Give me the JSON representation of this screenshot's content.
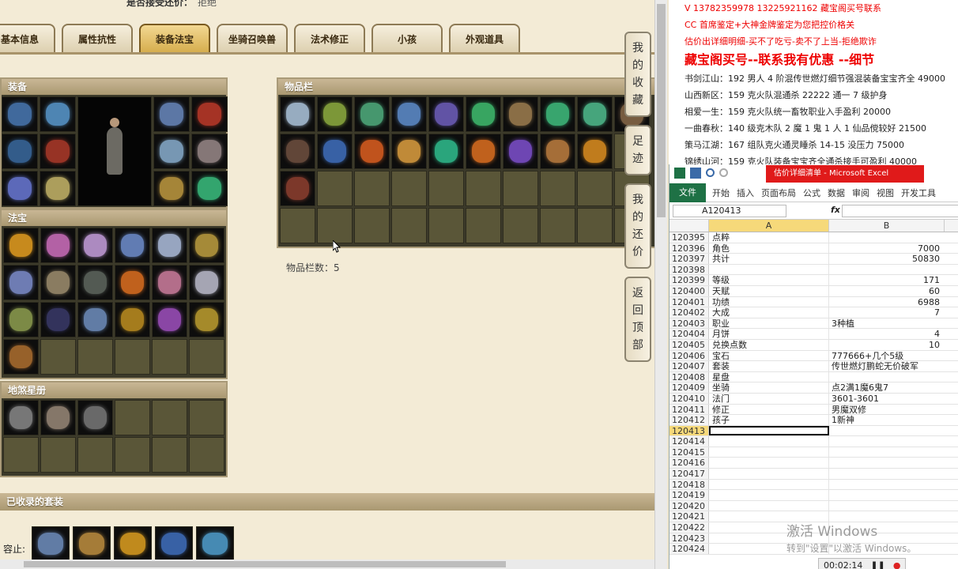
{
  "game": {
    "top_line": {
      "label": "是否接受还价：",
      "value": "拒绝"
    },
    "tabs": [
      {
        "label": "基本信息",
        "active": false
      },
      {
        "label": "属性抗性",
        "active": false
      },
      {
        "label": "装备法宝",
        "active": true
      },
      {
        "label": "坐骑召唤兽",
        "active": false
      },
      {
        "label": "法术修正",
        "active": false
      },
      {
        "label": "小孩",
        "active": false
      },
      {
        "label": "外观道具",
        "active": false
      }
    ],
    "panels": {
      "equip": "装备",
      "fabao": "法宝",
      "star": "地煞星册",
      "items": "物品栏",
      "sets": "已收录的套装"
    },
    "items_count": "物品栏数：5",
    "sets_label": "容止:",
    "side_buttons": [
      {
        "label": "我的收藏",
        "chars": [
          "我",
          "的",
          "收",
          "藏"
        ]
      },
      {
        "label": "足迹",
        "chars": [
          "足",
          "迹"
        ]
      },
      {
        "label": "我的还价",
        "chars": [
          "我",
          "的",
          "还",
          "价"
        ]
      },
      {
        "label": "返回顶部",
        "chars": [
          "返",
          "回",
          "顶",
          "部"
        ]
      }
    ],
    "equip_left_colors": [
      "#4a7ab5",
      "#5a9ad0",
      "#3a6aa0",
      "#b03a2a",
      "#6a7ad8",
      "#c8b86a"
    ],
    "equip_right_colors": [
      "#6a8ac0",
      "#c03a2a",
      "#8ab0d0",
      "#9a8a8a",
      "#c09a40",
      "#3ac080"
    ],
    "fabao_colors": [
      "#e8a020",
      "#d070c0",
      "#c8a0e0",
      "#7090d0",
      "#b0c0e0",
      "#c0a040",
      "#8090d0",
      "#a09070",
      "#606860",
      "#e07020",
      "#d080a0",
      "#c0c0d0",
      "#90a050",
      "#3a3a6a",
      "#7090c0",
      "#c09020",
      "#a050c0",
      "#c0a030",
      "#b07030",
      "",
      "",
      "",
      "",
      ""
    ],
    "star_colors": [
      "#8a8a8a",
      "#9a8a7a",
      "#7a7a7a",
      "",
      "",
      "",
      "",
      "",
      "",
      "",
      "",
      ""
    ],
    "item_colors": [
      "#b0c8e0",
      "#90b040",
      "#50b080",
      "#6090d0",
      "#7060c0",
      "#40c070",
      "#a08050",
      "#40c080",
      "#50c090",
      "#8a6a4a",
      "#705040",
      "#4070c0",
      "#e06020",
      "#e0a040",
      "#30c090",
      "#e07020",
      "#8050d0",
      "#c08040",
      "#e09020",
      "",
      "#904030",
      "",
      "",
      "",
      "",
      "",
      "",
      "",
      "",
      "",
      "",
      "",
      "",
      "",
      "",
      "",
      "",
      "",
      "",
      ""
    ],
    "sets_colors": [
      "#7090c0",
      "#c09040",
      "#e0a020",
      "#4070c0",
      "#50a0d0"
    ]
  },
  "doc": {
    "lines": [
      {
        "text": "V 13782359978    13225921162    藏宝阁买号联系",
        "style": "red"
      },
      {
        "text": "CC 首席鉴定+大神金牌鉴定为您把控价格关",
        "style": "red"
      },
      {
        "text": "估价出详细明细-买不了吃亏-卖不了上当-拒绝欺诈",
        "style": "red"
      },
      {
        "text": "藏宝阁买号--联系我有优惠 --细节",
        "style": "big"
      },
      {
        "text": "书剑江山：192 男人 4 阶混传世燃灯细节强混装备宝宝齐全 49000",
        "style": "normal"
      },
      {
        "text": "山西新区：159 克火队混通杀 22222 通一 7 级护身",
        "style": "normal"
      },
      {
        "text": "相爱一生：159 克火队统一畜牧职业入手盈利 20000",
        "style": "normal"
      },
      {
        "text": "一曲春秋：140 级克木队 2 魔 1 鬼 1 人 1 仙品傥较好 21500",
        "style": "normal"
      },
      {
        "text": "策马江湖：167 组队克火通灵睡杀 14-15 没压力 75000",
        "style": "normal"
      },
      {
        "text": "锦绣山河：159 克火队装备宝宝齐全通杀接手可盈利 40000",
        "style": "normal"
      }
    ]
  },
  "excel": {
    "title": "估价详细清单 - Microsoft Excel",
    "ribbon_file": "文件",
    "ribbon_tabs": [
      "开始",
      "插入",
      "页面布局",
      "公式",
      "数据",
      "审阅",
      "视图",
      "开发工具"
    ],
    "name_box": "A120413",
    "fx": "fx",
    "col_a": "A",
    "col_b": "B",
    "rows": [
      {
        "n": "120395",
        "a": "点粹",
        "b": "",
        "num": false
      },
      {
        "n": "120396",
        "a": "角色",
        "b": "7000",
        "num": true
      },
      {
        "n": "120397",
        "a": "共计",
        "b": "50830",
        "num": true
      },
      {
        "n": "120398",
        "a": "",
        "b": "",
        "num": false
      },
      {
        "n": "120399",
        "a": "等级",
        "b": "171",
        "num": true
      },
      {
        "n": "120400",
        "a": "天赋",
        "b": "60",
        "num": true
      },
      {
        "n": "120401",
        "a": "功绩",
        "b": "6988",
        "num": true
      },
      {
        "n": "120402",
        "a": "大成",
        "b": "7",
        "num": true
      },
      {
        "n": "120403",
        "a": "职业",
        "b": "3种植",
        "num": false
      },
      {
        "n": "120404",
        "a": "月饼",
        "b": "4",
        "num": true
      },
      {
        "n": "120405",
        "a": "兑换点数",
        "b": "10",
        "num": true
      },
      {
        "n": "120406",
        "a": "宝石",
        "b": "777666+几个5级",
        "num": false
      },
      {
        "n": "120407",
        "a": "套装",
        "b": "传世燃灯鹏蛇无价破军",
        "num": false
      },
      {
        "n": "120408",
        "a": "星盘",
        "b": "",
        "num": false
      },
      {
        "n": "120409",
        "a": "坐骑",
        "b": "点2满1魔6鬼7",
        "num": false
      },
      {
        "n": "120410",
        "a": "法门",
        "b": "3601-3601",
        "num": false
      },
      {
        "n": "120411",
        "a": "修正",
        "b": "男魔双修",
        "num": false
      },
      {
        "n": "120412",
        "a": "孩子",
        "b": "1新神",
        "num": false
      },
      {
        "n": "120413",
        "a": "",
        "b": "",
        "num": false,
        "selected": true
      },
      {
        "n": "120414",
        "a": "",
        "b": "",
        "num": false
      },
      {
        "n": "120415",
        "a": "",
        "b": "",
        "num": false
      },
      {
        "n": "120416",
        "a": "",
        "b": "",
        "num": false
      },
      {
        "n": "120417",
        "a": "",
        "b": "",
        "num": false
      },
      {
        "n": "120418",
        "a": "",
        "b": "",
        "num": false
      },
      {
        "n": "120419",
        "a": "",
        "b": "",
        "num": false
      },
      {
        "n": "120420",
        "a": "",
        "b": "",
        "num": false
      },
      {
        "n": "120421",
        "a": "",
        "b": "",
        "num": false
      },
      {
        "n": "120422",
        "a": "",
        "b": "",
        "num": false
      },
      {
        "n": "120423",
        "a": "",
        "b": "",
        "num": false
      },
      {
        "n": "120424",
        "a": "",
        "b": "",
        "num": false
      }
    ]
  },
  "overlay": {
    "watermark_1": "激活 Windows",
    "watermark_2": "转到\"设置\"以激活 Windows。",
    "timer": "00:02:14"
  }
}
